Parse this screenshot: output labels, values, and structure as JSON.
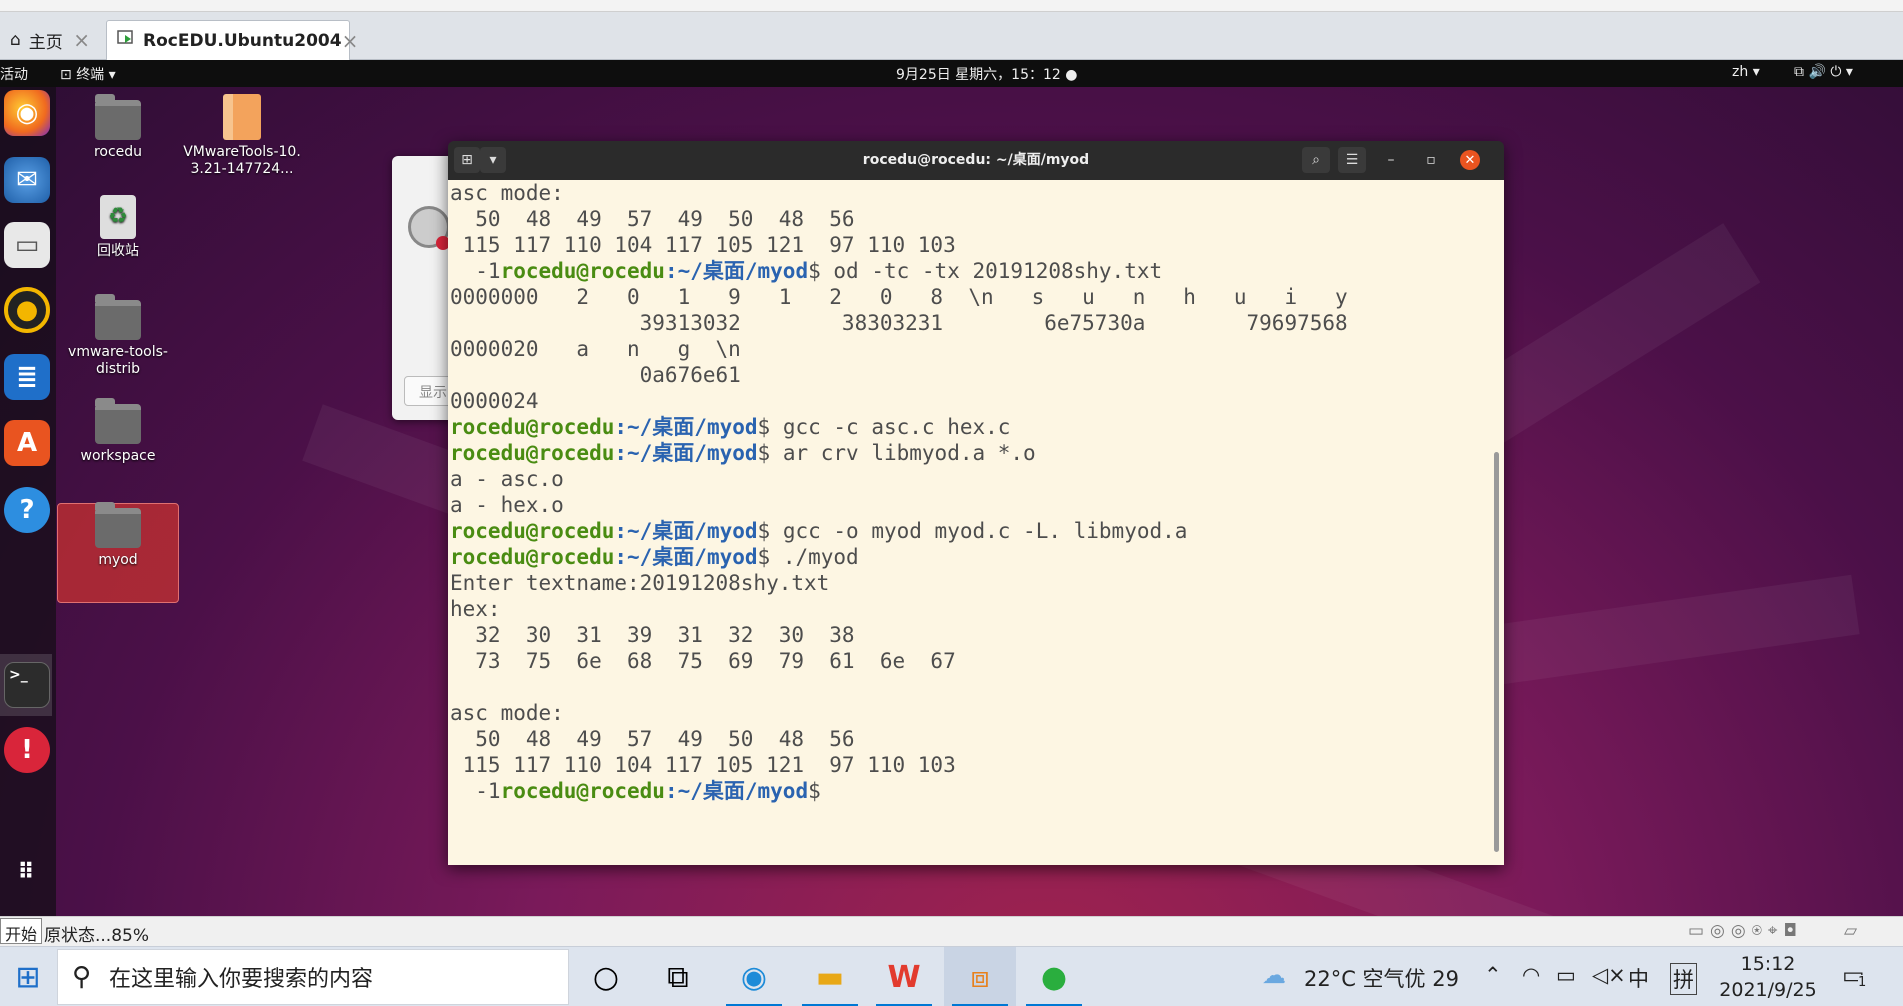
{
  "vmware": {
    "tabs": [
      {
        "label": "主页"
      },
      {
        "label": "RocEDU.Ubuntu2004"
      }
    ],
    "status_text": "原状态...85%",
    "start_tooltip": "开始"
  },
  "gnome": {
    "activities": "活动",
    "app_menu": "终端",
    "clock": "9月25日 星期六，15：12",
    "input_method": "zh"
  },
  "desktop_icons": [
    {
      "label": "rocedu"
    },
    {
      "label": "VMwareTools-10.3.21-147724..."
    },
    {
      "label": "回收站"
    },
    {
      "label": "vmware-tools-distrib"
    },
    {
      "label": "workspace"
    },
    {
      "label": "myod"
    }
  ],
  "background_dialog": {
    "button_label": "显示"
  },
  "terminal": {
    "title": "rocedu@rocedu: ~/桌面/myod",
    "prompt_user": "rocedu@rocedu",
    "prompt_path": ":~/桌面/myod",
    "prompt_symbol": "$",
    "lines": [
      {
        "text": "asc mode:"
      },
      {
        "text": "  50  48  49  57  49  50  48  56"
      },
      {
        "text": " 115 117 110 104 117 105 121  97 110 103"
      },
      {
        "pre": "  -1",
        "prompt": true,
        "cmd": " od -tc -tx 20191208shy.txt"
      },
      {
        "text": "0000000   2   0   1   9   1   2   0   8  \\n   s   u   n   h   u   i   y"
      },
      {
        "text": "               39313032        38303231        6e75730a        79697568"
      },
      {
        "text": "0000020   a   n   g  \\n"
      },
      {
        "text": "               0a676e61"
      },
      {
        "text": "0000024"
      },
      {
        "pre": "",
        "prompt": true,
        "cmd": " gcc -c asc.c hex.c"
      },
      {
        "pre": "",
        "prompt": true,
        "cmd": " ar crv libmyod.a *.o"
      },
      {
        "text": "a - asc.o"
      },
      {
        "text": "a - hex.o"
      },
      {
        "pre": "",
        "prompt": true,
        "cmd": " gcc -o myod myod.c -L. libmyod.a"
      },
      {
        "pre": "",
        "prompt": true,
        "cmd": " ./myod"
      },
      {
        "text": "Enter textname:20191208shy.txt"
      },
      {
        "text": "hex:"
      },
      {
        "text": "  32  30  31  39  31  32  30  38"
      },
      {
        "text": "  73  75  6e  68  75  69  79  61  6e  67"
      },
      {
        "text": ""
      },
      {
        "text": "asc mode:"
      },
      {
        "text": "  50  48  49  57  49  50  48  56"
      },
      {
        "text": " 115 117 110 104 117 105 121  97 110 103"
      },
      {
        "pre": "  -1",
        "prompt": true,
        "cmd": ""
      }
    ]
  },
  "windows_taskbar": {
    "search_placeholder": "在这里输入你要搜索的内容",
    "weather": "22°C 空气优 29",
    "ime_lang": "中",
    "ime_mode": "拼",
    "time": "15:12",
    "date": "2021/9/25",
    "notification_count": "1"
  },
  "colors": {
    "prompt_user": "#4a8c12",
    "prompt_path": "#2a63b0",
    "terminal_bg": "#fdf6e3",
    "terminal_text": "#4d4d4d"
  }
}
